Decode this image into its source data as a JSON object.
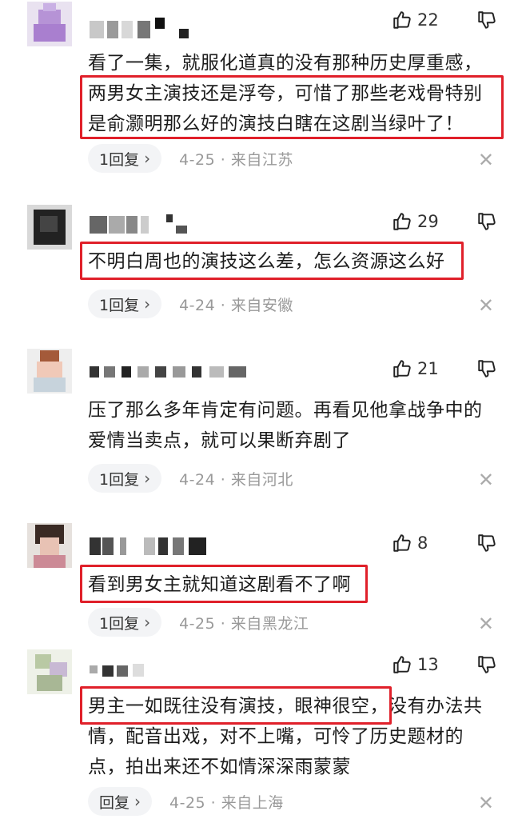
{
  "comments": [
    {
      "likes": "22",
      "lines": [
        "看了一集，就服化道真的没有那种历史厚重感，",
        "两男女主演技还是浮夸，可惜了那些老戏骨特别",
        "是俞灏明那么好的演技白瞎在这剧当绿叶了！"
      ],
      "reply_label": "1回复",
      "date": "4-25 · 来自江苏"
    },
    {
      "likes": "29",
      "lines": [
        "不明白周也的演技这么差，怎么资源这么好"
      ],
      "reply_label": "1回复",
      "date": "4-24 · 来自安徽"
    },
    {
      "likes": "21",
      "lines": [
        "压了那么多年肯定有问题。再看见他拿战争中的",
        "爱情当卖点，就可以果断弃剧了"
      ],
      "reply_label": "1回复",
      "date": "4-24 · 来自河北"
    },
    {
      "likes": "8",
      "lines": [
        "看到男女主就知道这剧看不了啊"
      ],
      "reply_label": "1回复",
      "date": "4-25 · 来自黑龙江"
    },
    {
      "likes": "13",
      "lines": [
        "男主一如既往没有演技，眼神很空，没有办法共",
        "情，配音出戏，对不上嘴，可怜了历史题材的",
        "点，拍出来还不如情深深雨蒙蒙"
      ],
      "reply_label": "回复",
      "date": "4-25 · 来自上海"
    }
  ],
  "colors": {
    "highlight": "#e0202a",
    "chip_bg": "#f3f4f6",
    "meta_text": "#999999"
  },
  "icons": {
    "like": "thumbs-up-icon",
    "dislike": "thumbs-down-icon",
    "reply_arrow": "chevron-right-icon",
    "dismiss": "close-icon"
  }
}
